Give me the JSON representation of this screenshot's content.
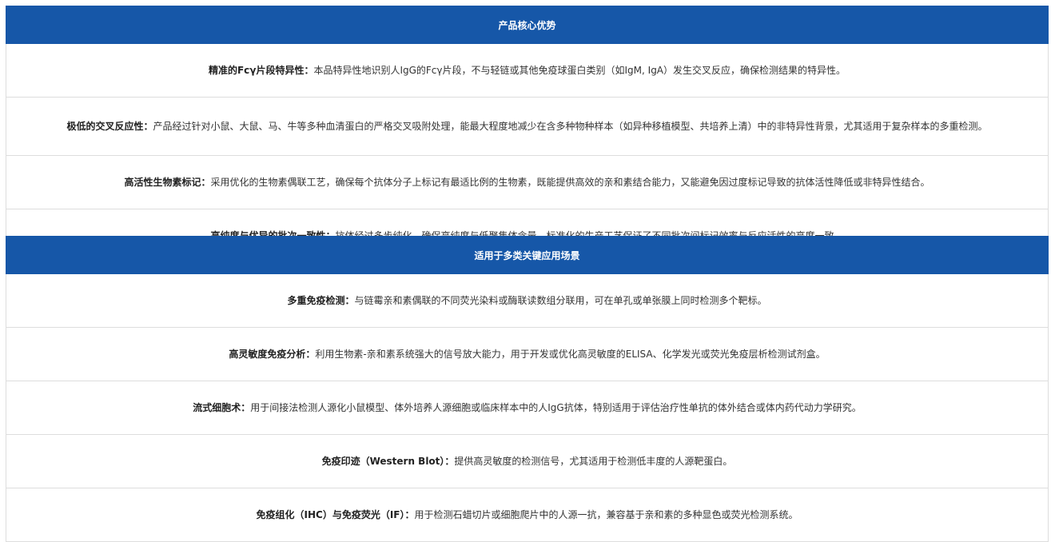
{
  "advantages": {
    "header": "产品核心优势",
    "rows": [
      {
        "bold": "精准的Fcγ片段特异性：",
        "text": "本品特异性地识别人IgG的Fcγ片段，不与轻链或其他免疫球蛋白类别（如IgM, IgA）发生交叉反应，确保检测结果的特异性。"
      },
      {
        "bold": "极低的交叉反应性：",
        "text": "产品经过针对小鼠、大鼠、马、牛等多种血清蛋白的严格交叉吸附处理，能最大程度地减少在含多种物种样本（如异种移植模型、共培养上清）中的非特异性背景，尤其适用于复杂样本的多重检测。"
      },
      {
        "bold": "高活性生物素标记：",
        "text": "采用优化的生物素偶联工艺，确保每个抗体分子上标记有最适比例的生物素，既能提供高效的亲和素结合能力，又能避免因过度标记导致的抗体活性降低或非特异性结合。"
      },
      {
        "bold": "高纯度与优异的批次一致性：",
        "text": "抗体经过多步纯化，确保高纯度与低聚集体含量。标准化的生产工艺保证了不同批次间标记效率与反应活性的高度一致。"
      }
    ]
  },
  "applications": {
    "header": "适用于多类关键应用场景",
    "rows": [
      {
        "bold": "多重免疫检测：",
        "text": "与链霉亲和素偶联的不同荧光染料或酶联读数组分联用，可在单孔或单张膜上同时检测多个靶标。"
      },
      {
        "bold": "高灵敏度免疫分析：",
        "text": "利用生物素-亲和素系统强大的信号放大能力，用于开发或优化高灵敏度的ELISA、化学发光或荧光免疫层析检测试剂盒。"
      },
      {
        "bold": "流式细胞术：",
        "text": "用于间接法检测人源化小鼠模型、体外培养人源细胞或临床样本中的人IgG抗体，特别适用于评估治疗性单抗的体外结合或体内药代动力学研究。"
      },
      {
        "bold": "免疫印迹（Western Blot）：",
        "text": "提供高灵敏度的检测信号，尤其适用于检测低丰度的人源靶蛋白。"
      },
      {
        "bold": "免疫组化（IHC）与免疫荧光（IF）：",
        "text": "用于检测石蜡切片或细胞爬片中的人源一抗，兼容基于亲和素的多种显色或荧光检测系统。"
      }
    ]
  }
}
